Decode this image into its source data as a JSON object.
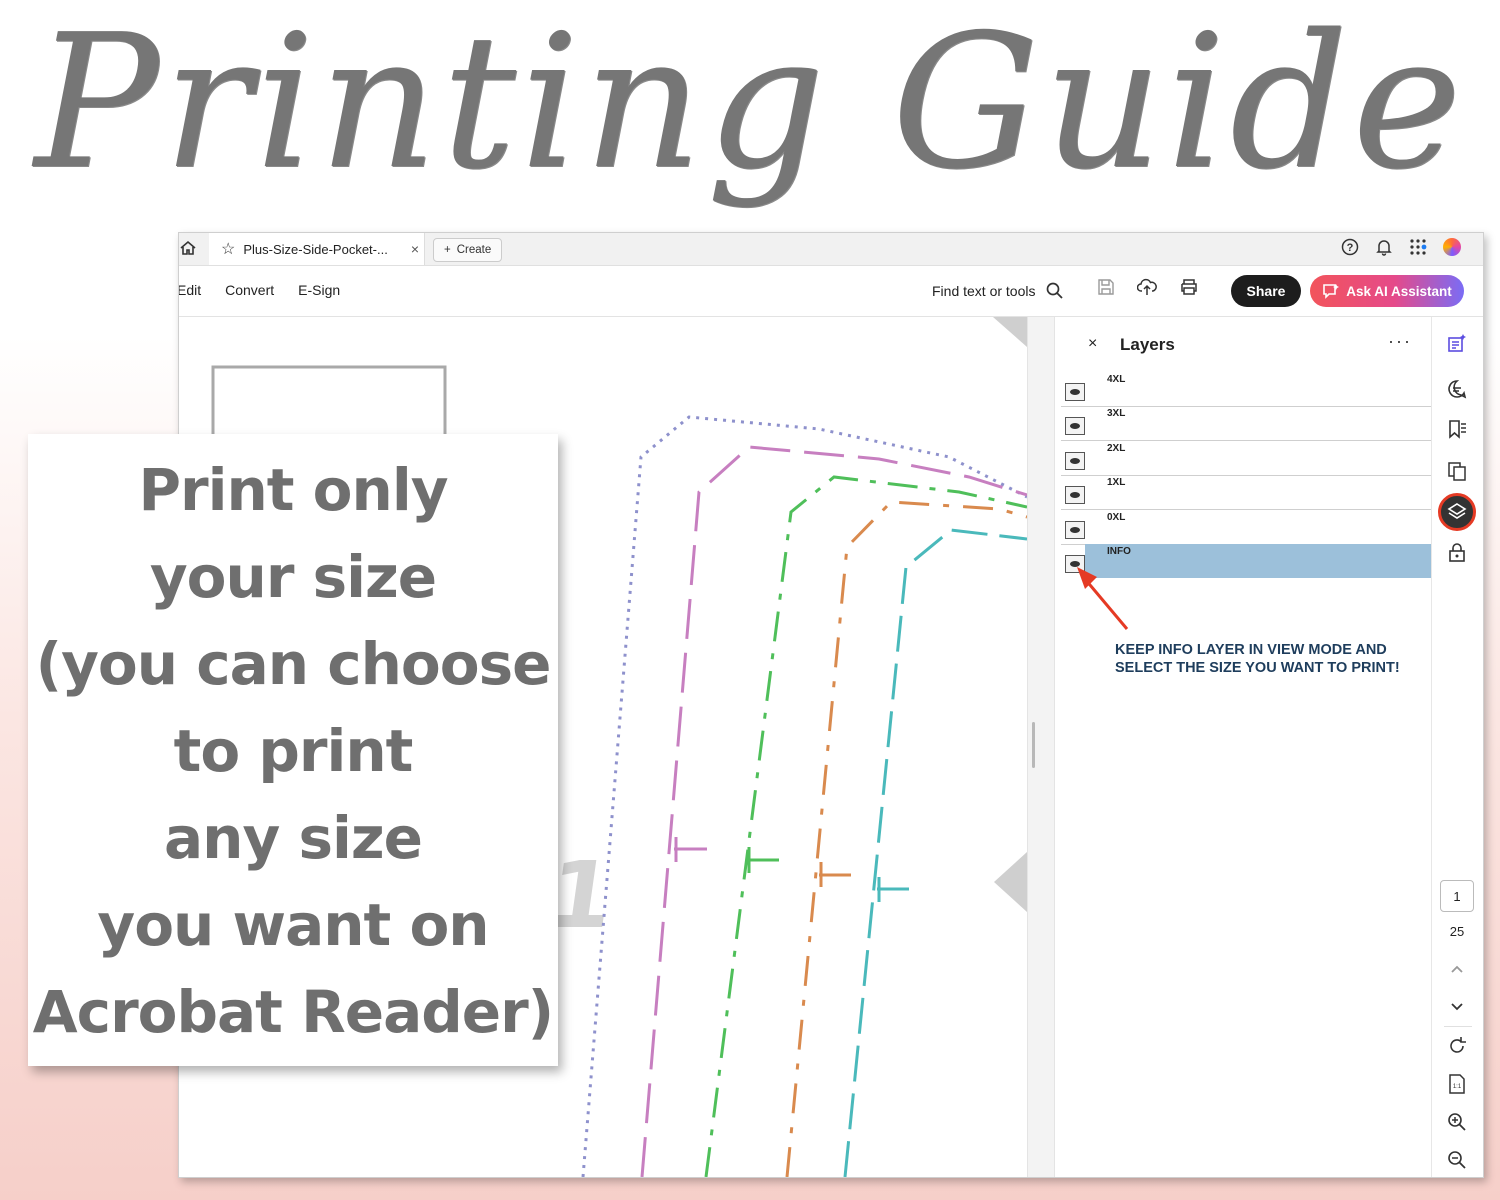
{
  "hero": {
    "title": "Printing Guide"
  },
  "browser": {
    "tab_label": "Plus-Size-Side-Pocket-...",
    "tab_close": "×",
    "create_label": "Create"
  },
  "toolbar": {
    "menu": [
      "Edit",
      "Convert",
      "E-Sign"
    ],
    "find_label": "Find text or tools",
    "share_label": "Share",
    "ai_label": "Ask AI Assistant"
  },
  "layers": {
    "title": "Layers",
    "close": "×",
    "more": "···",
    "items": [
      {
        "label": "4XL",
        "selected": false
      },
      {
        "label": "3XL",
        "selected": false
      },
      {
        "label": "2XL",
        "selected": false
      },
      {
        "label": "1XL",
        "selected": false
      },
      {
        "label": "0XL",
        "selected": false
      },
      {
        "label": "INFO",
        "selected": true
      }
    ],
    "note": "KEEP INFO LAYER IN VIEW MODE AND SELECT THE SIZE YOU WANT TO PRINT!"
  },
  "document": {
    "piece_label": "A1"
  },
  "pager": {
    "current": "1",
    "total": "25"
  },
  "card": {
    "lines": [
      "Print only",
      "your size",
      "(you can choose",
      "to print",
      "any size",
      "you want on",
      "Acrobat Reader)"
    ]
  },
  "colors": {
    "share": "#1d1d1d",
    "ai_gradient": [
      "#f2545b",
      "#7a6cf5"
    ],
    "layer_selected": "#9cc0da",
    "note_text": "#1e3d5c",
    "arrow": "#e53a24",
    "pattern_lines": [
      "#8e91cc",
      "#c77fc0",
      "#4fbf5a",
      "#d98a4e",
      "#4ab9bb"
    ]
  },
  "icons": {
    "tabbar": [
      "home-icon",
      "star-icon",
      "help-icon",
      "bell-icon",
      "apps-icon",
      "avatar"
    ],
    "toolbar": [
      "search-icon",
      "save-icon",
      "upload-icon",
      "print-icon",
      "ai-chat-icon"
    ],
    "rail": [
      "ai-summary-icon",
      "comment-icon",
      "bookmark-icon",
      "pages-icon",
      "layers-icon",
      "lock-icon",
      "chevron-up-icon",
      "chevron-down-icon",
      "rotate-icon",
      "page-fit-icon",
      "zoom-in-icon",
      "zoom-out-icon"
    ]
  }
}
